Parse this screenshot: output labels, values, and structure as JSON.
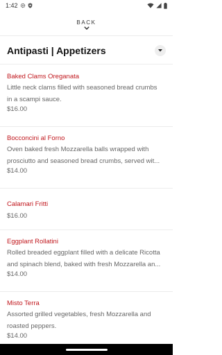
{
  "status_bar": {
    "time": "1:42"
  },
  "header": {
    "back_label": "BACK"
  },
  "category": {
    "title": "Antipasti | Appetizers"
  },
  "menu_items": [
    {
      "name": "Baked Clams Oreganata",
      "description_lines": [
        "Little neck clams filled with seasoned bread crumbs",
        "in a scampi sauce."
      ],
      "price": "$16.00"
    },
    {
      "name": "Bocconcini al Forno",
      "description_lines": [
        "Oven baked fresh Mozzarella balls wrapped with",
        "prosciutto and seasoned bread crumbs, served wit..."
      ],
      "price": "$14.00"
    },
    {
      "name": "Calamari Fritti",
      "description_lines": [],
      "price": "$16.00"
    },
    {
      "name": "Eggplant Rollatini",
      "description_lines": [
        "Rolled breaded eggplant filled with a delicate Ricotta",
        "and spinach blend, baked with fresh Mozzarella an..."
      ],
      "price": "$14.00"
    },
    {
      "name": "Misto Terra",
      "description_lines": [
        "Assorted grilled vegetables, fresh Mozzarella and",
        "roasted peppers."
      ],
      "price": "$14.00"
    }
  ]
}
